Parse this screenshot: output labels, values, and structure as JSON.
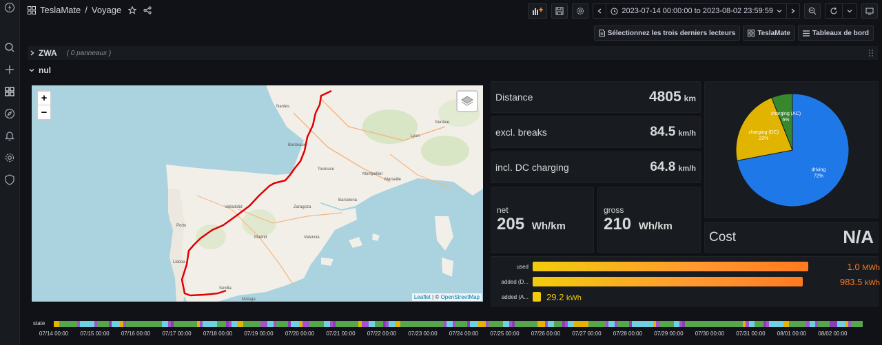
{
  "header": {
    "app": "TeslaMate",
    "sep": "/",
    "page": "Voyage",
    "time_range": "2023-07-14 00:00:00 to 2023-08-02 23:59:59"
  },
  "links": {
    "recent": "Sélectionnez les trois derniers lecteurs",
    "teslamate": "TeslaMate",
    "dashboards": "Tableaux de bord"
  },
  "rows": {
    "zwa_title": "ZWA",
    "zwa_count": "( 0 panneaux )",
    "nul_title": "nul"
  },
  "map": {
    "zoom_in": "+",
    "zoom_out": "−",
    "attr_leaflet": "Leaflet",
    "attr_sep": " | © ",
    "attr_osm": "OpenStreetMap",
    "place_labels": [
      "Bordeaux",
      "Toulouse",
      "Marseille",
      "Valladolid",
      "Madrid",
      "Zaragoza",
      "Barcelona",
      "Lisboa",
      "Porto",
      "Sevilla",
      "Málaga",
      "Valencia",
      "Nantes",
      "Genève",
      "Lyon",
      "Montpellier"
    ]
  },
  "stats": {
    "distance_label": "Distance",
    "distance_value": "4805",
    "distance_unit": "km",
    "excl_label": "excl. breaks",
    "excl_value": "84.5",
    "excl_unit": "km/h",
    "incl_label": "incl. DC charging",
    "incl_value": "64.8",
    "incl_unit": "km/h",
    "net_label": "net",
    "net_value": "205",
    "net_unit": "Wh/km",
    "gross_label": "gross",
    "gross_value": "210",
    "gross_unit": "Wh/km",
    "cost_label": "Cost",
    "cost_value": "N/A"
  },
  "chart_data": {
    "type": "pie",
    "series": [
      {
        "name": "driving",
        "percent": 72,
        "color": "#1f78e8"
      },
      {
        "name": "charging (DC)",
        "percent": 22,
        "color": "#e0b400"
      },
      {
        "name": "charging (AC)",
        "percent": 6,
        "color": "#37872d"
      }
    ]
  },
  "bars": [
    {
      "label": "used",
      "value": "1.0",
      "unit": "MWh",
      "fill": 1.0,
      "color": "orange"
    },
    {
      "label": "added (D...",
      "value": "983.5",
      "unit": "kWh",
      "fill": 0.98,
      "color": "orange"
    },
    {
      "label": "added (A...",
      "value": "29.2",
      "unit": "kWh",
      "fill": 0.03,
      "color": "yellow"
    }
  ],
  "timeline": {
    "label": "state",
    "ticks": [
      "07/14 00:00",
      "07/15 00:00",
      "07/16 00:00",
      "07/17 00:00",
      "07/18 00:00",
      "07/19 00:00",
      "07/20 00:00",
      "07/21 00:00",
      "07/22 00:00",
      "07/23 00:00",
      "07/24 00:00",
      "07/25 00:00",
      "07/26 00:00",
      "07/27 00:00",
      "07/28 00:00",
      "07/29 00:00",
      "07/30 00:00",
      "07/31 00:00",
      "08/01 00:00",
      "08/02 00:00"
    ],
    "colors": {
      "driving": "#56a64b",
      "charging": "#e0b400",
      "parked": "#6ed0e0",
      "online": "#a352cc",
      "asleep": "#8f3bb8"
    }
  }
}
